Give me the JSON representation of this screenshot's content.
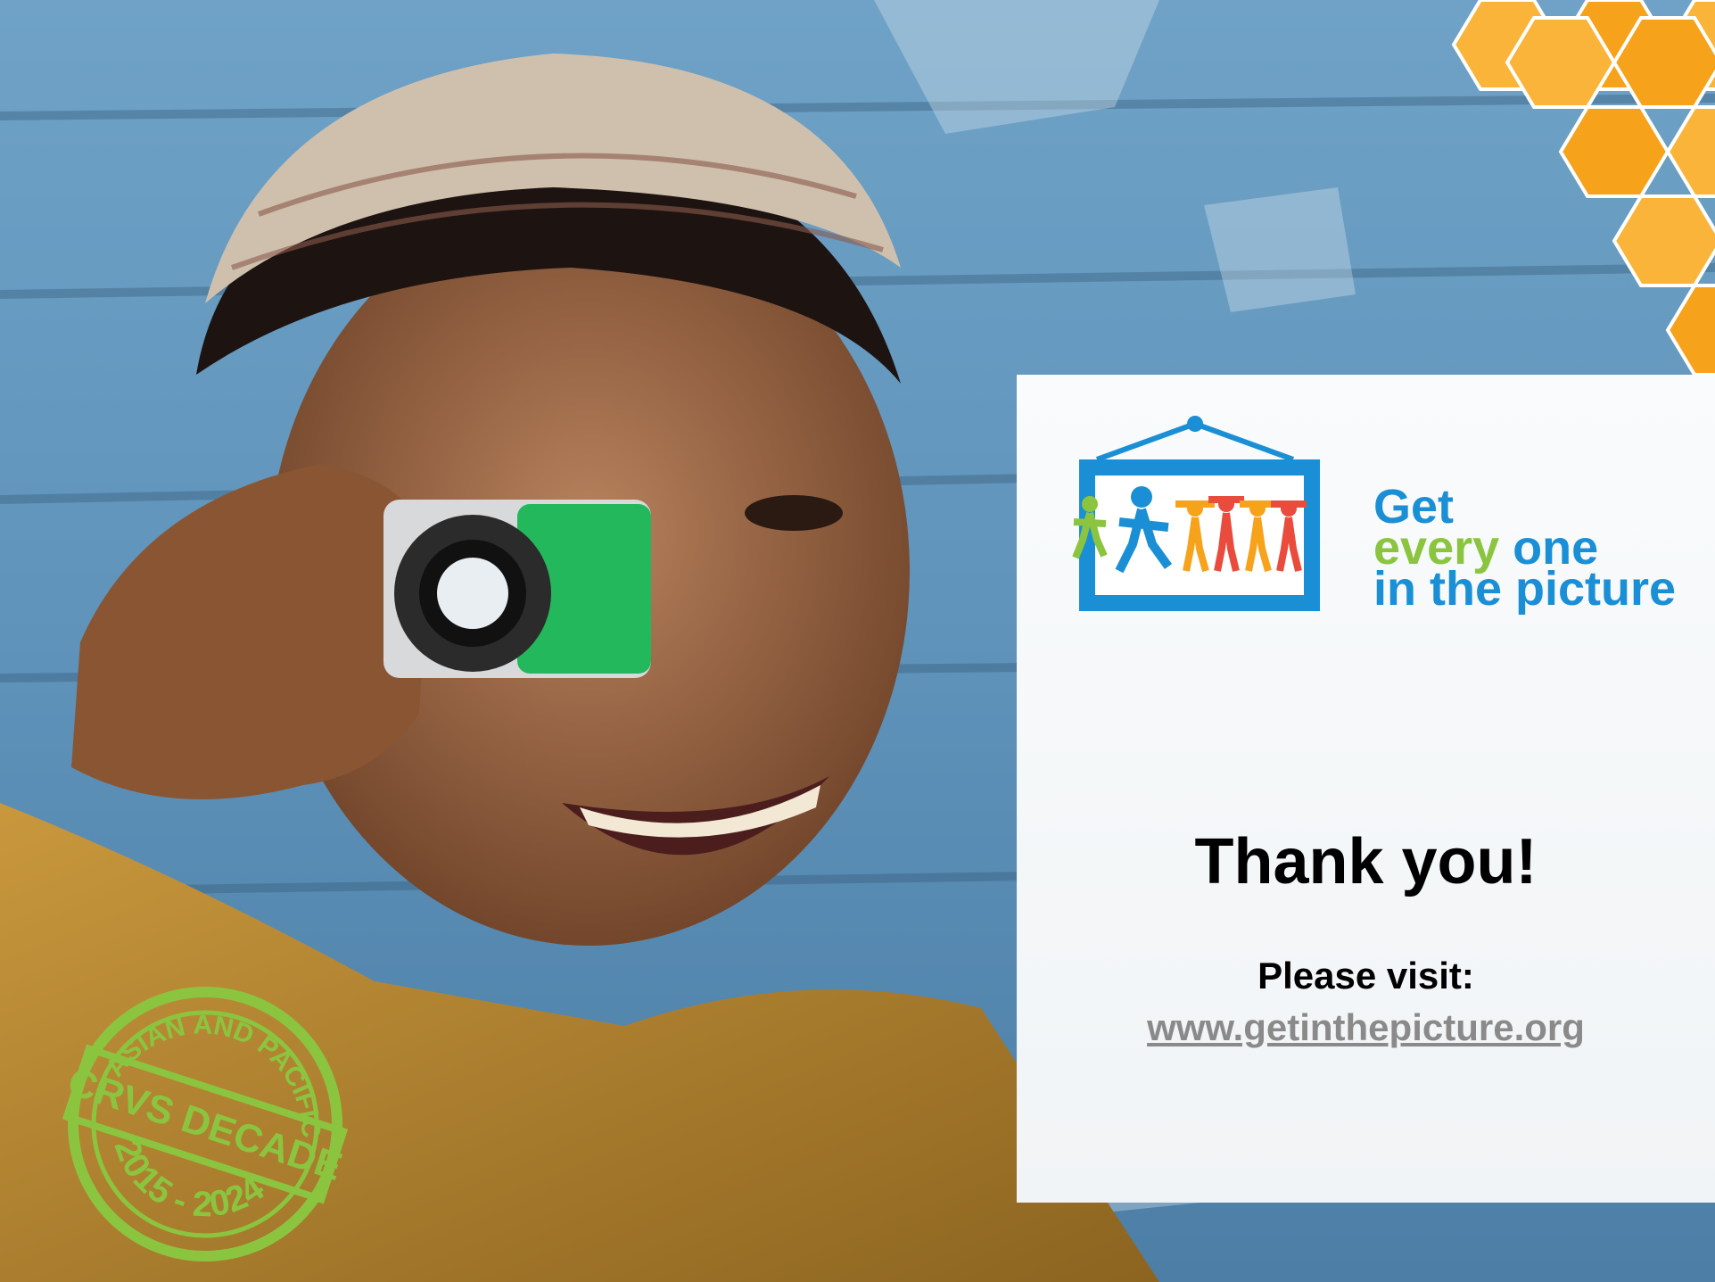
{
  "logo": {
    "line1": "Get",
    "line2_green": "every",
    "line2_blue": "one",
    "line3": "in the picture"
  },
  "message": {
    "title": "Thank you!",
    "visit_label": "Please visit:",
    "url": "www.getinthepicture.org"
  },
  "stamp": {
    "top": "ASIAN AND PACIFIC",
    "middle": "CRVS DECADE",
    "bottom": "2015 - 2024"
  },
  "colors": {
    "logo_blue": "#1a8fd5",
    "logo_green": "#8bc53f",
    "stamp_green": "#8bc53f",
    "hex_orange": "#f7a21b"
  }
}
